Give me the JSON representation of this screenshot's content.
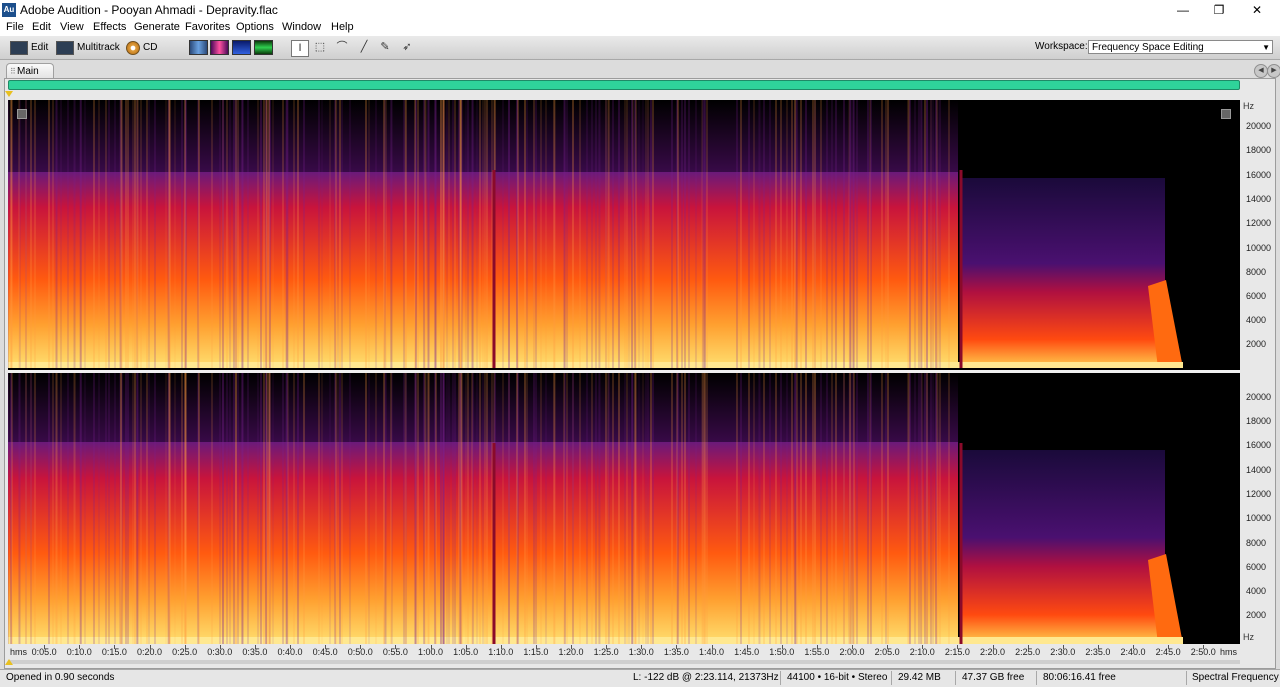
{
  "window": {
    "app_icon": "Au",
    "title": "Adobe Audition - Pooyan Ahmadi - Depravity.flac",
    "minimize": "—",
    "restore": "❐",
    "close": "✕"
  },
  "menu": [
    "File",
    "Edit",
    "View",
    "Effects",
    "Generate",
    "Favorites",
    "Options",
    "Window",
    "Help"
  ],
  "toolbar": {
    "edit_label": "Edit",
    "multitrack_label": "Multitrack",
    "cd_label": "CD",
    "workspace_label": "Workspace:",
    "workspace_value": "Frequency Space Editing"
  },
  "panel": {
    "tab_label": "Main",
    "tab_grip": "⠿"
  },
  "frequency_axis": {
    "unit": "Hz",
    "channel1_labels": [
      "20000",
      "18000",
      "16000",
      "14000",
      "12000",
      "10000",
      "8000",
      "6000",
      "4000",
      "2000"
    ],
    "channel2_labels": [
      "20000",
      "18000",
      "16000",
      "14000",
      "12000",
      "10000",
      "8000",
      "6000",
      "4000",
      "2000"
    ],
    "channel2_unit": "Hz"
  },
  "time_axis": {
    "unit_left": "hms",
    "unit_right": "hms",
    "labels": [
      "0:05.0",
      "0:10.0",
      "0:15.0",
      "0:20.0",
      "0:25.0",
      "0:30.0",
      "0:35.0",
      "0:40.0",
      "0:45.0",
      "0:50.0",
      "0:55.0",
      "1:00.0",
      "1:05.0",
      "1:10.0",
      "1:15.0",
      "1:20.0",
      "1:25.0",
      "1:30.0",
      "1:35.0",
      "1:40.0",
      "1:45.0",
      "1:50.0",
      "1:55.0",
      "2:00.0",
      "2:05.0",
      "2:10.0",
      "2:15.0",
      "2:20.0",
      "2:25.0",
      "2:30.0",
      "2:35.0",
      "2:40.0",
      "2:45.0",
      "2:50.0"
    ],
    "label_seconds": [
      5,
      10,
      15,
      20,
      25,
      30,
      35,
      40,
      45,
      50,
      55,
      60,
      65,
      70,
      75,
      80,
      85,
      90,
      95,
      100,
      105,
      110,
      115,
      120,
      125,
      130,
      135,
      140,
      145,
      150,
      155,
      160,
      165,
      170
    ]
  },
  "status": {
    "message": "Opened in 0.90 seconds",
    "cursor": "L: -122 dB @ 2:23.114, 21373Hz",
    "format": "44100 • 16-bit • Stereo",
    "size": "29.42 MB",
    "disk_free": "47.37 GB free",
    "time_free": "80:06:16.41 free",
    "view_mode": "Spectral Frequency"
  },
  "colors": {
    "overview": "#2fd39a",
    "spectrum_low": "#ffe070",
    "spectrum_mid": "#ff7a1a",
    "spectrum_high": "#c8143c",
    "spectrum_top": "#6a1a7a"
  }
}
